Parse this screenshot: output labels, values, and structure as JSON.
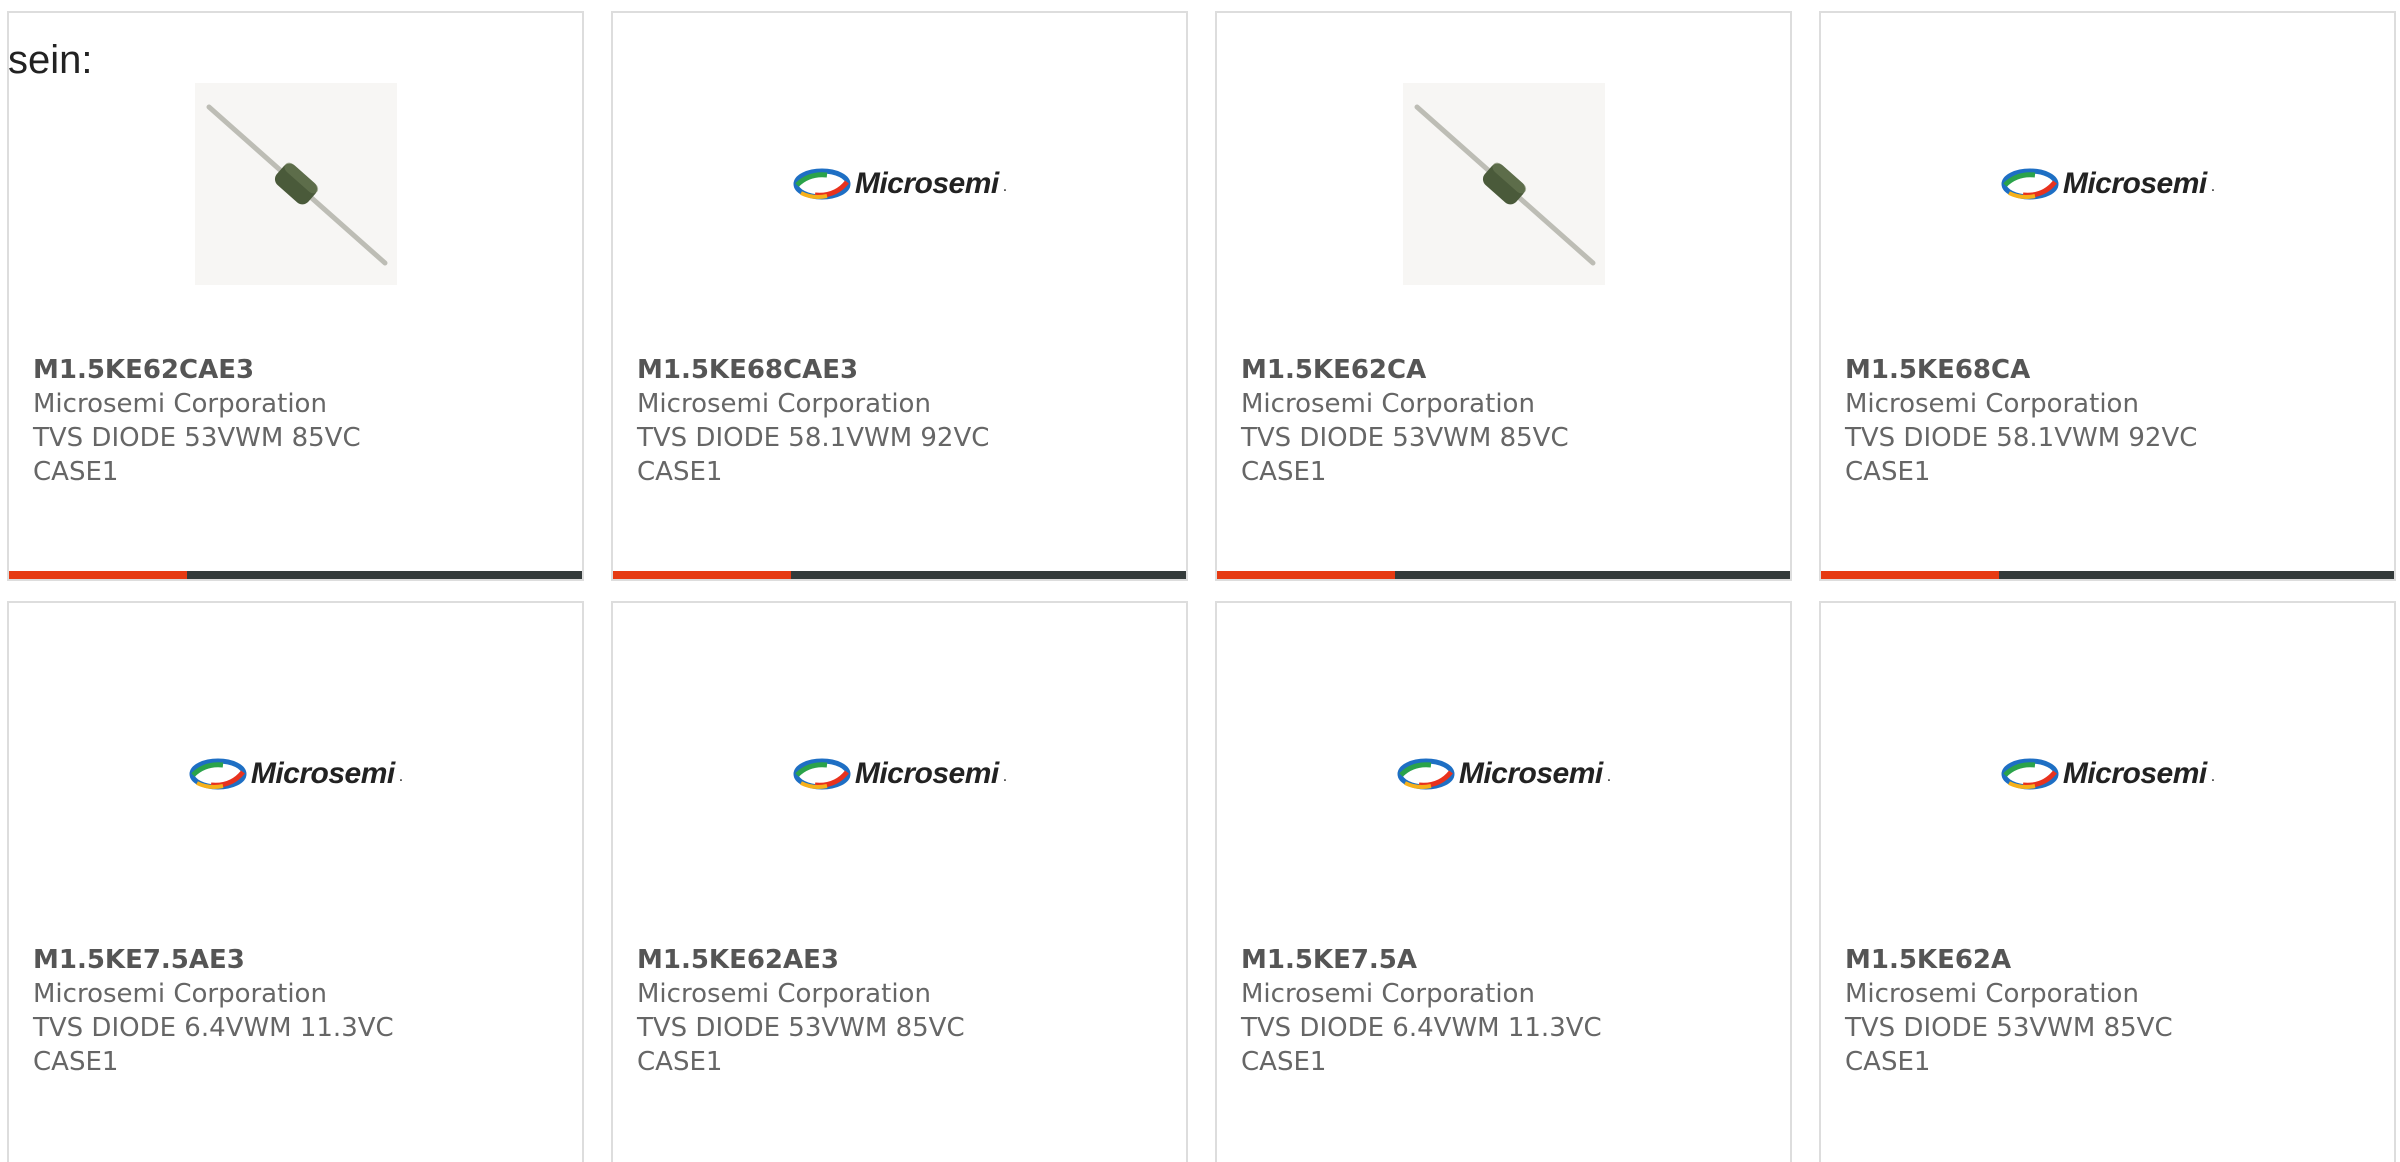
{
  "intro_text": "sein:",
  "colors": {
    "accent": "#e63a12",
    "bar_dark": "#333a3a",
    "card_border": "#dddddd",
    "text_gray": "#666666"
  },
  "products": [
    {
      "part": "M1.5KE62CAE3",
      "manufacturer": "Microsemi Corporation",
      "description": "TVS DIODE 53VWM 85VC CASE1",
      "image": "diode-photo",
      "logo_text": "Microsemi",
      "bar_fill": 0.31
    },
    {
      "part": "M1.5KE68CAE3",
      "manufacturer": "Microsemi Corporation",
      "description": "TVS DIODE 58.1VWM 92VC CASE1",
      "image": "microsemi-logo",
      "logo_text": "Microsemi",
      "bar_fill": 0.31
    },
    {
      "part": "M1.5KE62CA",
      "manufacturer": "Microsemi Corporation",
      "description": "TVS DIODE 53VWM 85VC CASE1",
      "image": "diode-photo",
      "logo_text": "Microsemi",
      "bar_fill": 0.31
    },
    {
      "part": "M1.5KE68CA",
      "manufacturer": "Microsemi Corporation",
      "description": "TVS DIODE 58.1VWM 92VC CASE1",
      "image": "microsemi-logo",
      "logo_text": "Microsemi",
      "bar_fill": 0.31
    },
    {
      "part": "M1.5KE7.5AE3",
      "manufacturer": "Microsemi Corporation",
      "description": "TVS DIODE 6.4VWM 11.3VC CASE1",
      "image": "microsemi-logo",
      "logo_text": "Microsemi"
    },
    {
      "part": "M1.5KE62AE3",
      "manufacturer": "Microsemi Corporation",
      "description": "TVS DIODE 53VWM 85VC CASE1",
      "image": "microsemi-logo",
      "logo_text": "Microsemi"
    },
    {
      "part": "M1.5KE7.5A",
      "manufacturer": "Microsemi Corporation",
      "description": "TVS DIODE 6.4VWM 11.3VC CASE1",
      "image": "microsemi-logo",
      "logo_text": "Microsemi"
    },
    {
      "part": "M1.5KE62A",
      "manufacturer": "Microsemi Corporation",
      "description": "TVS DIODE 53VWM 85VC CASE1",
      "image": "microsemi-logo",
      "logo_text": "Microsemi"
    }
  ]
}
